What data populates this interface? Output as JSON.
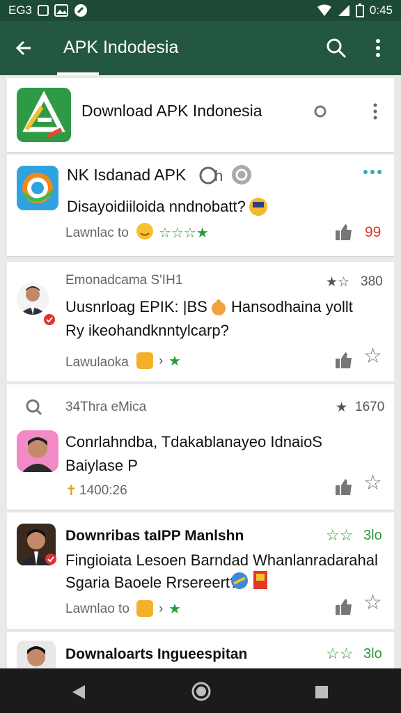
{
  "status_bar": {
    "left_text": "EG3",
    "time": "0:45",
    "icons": [
      "notification-icon",
      "photo-icon",
      "sync-icon",
      "wifi-icon",
      "signal-icon",
      "battery-icon"
    ]
  },
  "app_bar": {
    "title": "APK Indodesia"
  },
  "header_card": {
    "title": "Download APK Indonesia"
  },
  "cards": [
    {
      "title": "NK Isdanad APK",
      "title_extra": "h",
      "body_lines": [
        "Disayoidiiloida nndnobatt?"
      ],
      "footer": "Lawnlac to",
      "count": "99"
    },
    {
      "meta": "Emonadcama S'IH1",
      "rating": "380",
      "body_lines": [
        "Uusnrloag EPIK: |BS",
        "Hansodhaina yollt",
        "Ry ikeohandknntylcarp?"
      ],
      "footer": "Lawulaoka"
    },
    {
      "meta": "34Thra eMica",
      "rating": "1670",
      "body_lines": [
        "Conrlahndba, Tdakablanayeo IdnaioS",
        "Baiylase P"
      ],
      "time": "1400:26"
    },
    {
      "title": "Downribas taIPP Manlshn",
      "rating": "3lo",
      "body_lines": [
        "Fingioiata Lesoen Barndad Whanlanradarahal",
        "Sgaria Baoele Rrsereert?"
      ],
      "footer": "Lawnlao to"
    },
    {
      "title": "Downaloarts Ingueespitan",
      "rating": "3lo"
    }
  ],
  "colors": {
    "status_bar": "#1d4a36",
    "app_bar": "#245741",
    "accent_green": "#2a9a3a",
    "count_red": "#d23a2a"
  }
}
